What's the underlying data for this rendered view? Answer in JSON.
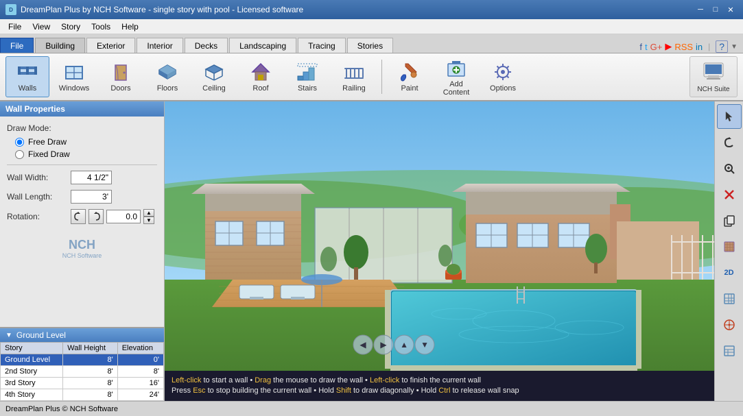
{
  "titleBar": {
    "title": "DreamPlan Plus by NCH Software - single story with pool - Licensed software",
    "iconText": "D",
    "minBtn": "─",
    "maxBtn": "□",
    "closeBtn": "✕"
  },
  "menuBar": {
    "items": [
      "File",
      "View",
      "Story",
      "Tools",
      "Help"
    ]
  },
  "tabs": {
    "main": [
      {
        "label": "File",
        "active": true
      },
      {
        "label": "Building",
        "active": false
      },
      {
        "label": "Exterior",
        "active": false
      },
      {
        "label": "Interior",
        "active": false
      },
      {
        "label": "Decks",
        "active": false
      },
      {
        "label": "Landscaping",
        "active": false
      },
      {
        "label": "Tracing",
        "active": false
      },
      {
        "label": "Stories",
        "active": false
      }
    ]
  },
  "toolbar": {
    "tools": [
      {
        "id": "walls",
        "label": "Walls",
        "active": true
      },
      {
        "id": "windows",
        "label": "Windows",
        "active": false
      },
      {
        "id": "doors",
        "label": "Doors",
        "active": false
      },
      {
        "id": "floors",
        "label": "Floors",
        "active": false
      },
      {
        "id": "ceiling",
        "label": "Ceiling",
        "active": false
      },
      {
        "id": "roof",
        "label": "Roof",
        "active": false
      },
      {
        "id": "stairs",
        "label": "Stairs",
        "active": false
      },
      {
        "id": "railing",
        "label": "Railing",
        "active": false
      },
      {
        "id": "paint",
        "label": "Paint",
        "active": false
      },
      {
        "id": "addcontent",
        "label": "Add Content",
        "active": false
      },
      {
        "id": "options",
        "label": "Options",
        "active": false
      }
    ],
    "nchSuite": "NCH Suite"
  },
  "wallProperties": {
    "title": "Wall Properties",
    "drawModeLabel": "Draw Mode:",
    "freeDrawLabel": "Free Draw",
    "fixedDrawLabel": "Fixed Draw",
    "wallWidthLabel": "Wall Width:",
    "wallWidthValue": "4 1/2\"",
    "wallLengthLabel": "Wall Length:",
    "wallLengthValue": "3'",
    "rotationLabel": "Rotation:",
    "rotationValue": "0.0"
  },
  "groundLevel": {
    "title": "Ground Level",
    "table": {
      "headers": [
        "Story",
        "Wall Height",
        "Elevation"
      ],
      "rows": [
        {
          "story": "Ground Level",
          "wallHeight": "8'",
          "elevation": "0'",
          "selected": true
        },
        {
          "story": "2nd Story",
          "wallHeight": "8'",
          "elevation": "8'",
          "selected": false
        },
        {
          "story": "3rd Story",
          "wallHeight": "8'",
          "elevation": "16'",
          "selected": false
        },
        {
          "story": "4th Story",
          "wallHeight": "8'",
          "elevation": "24'",
          "selected": false
        }
      ]
    }
  },
  "rightToolbar": {
    "buttons": [
      {
        "id": "cursor",
        "icon": "☜",
        "label": "cursor-tool"
      },
      {
        "id": "rotate",
        "icon": "↺",
        "label": "rotate-tool"
      },
      {
        "id": "zoom",
        "icon": "⊕",
        "label": "zoom-tool"
      },
      {
        "id": "delete",
        "icon": "✕",
        "label": "delete-tool"
      },
      {
        "id": "copy",
        "icon": "⧉",
        "label": "copy-tool"
      },
      {
        "id": "texture",
        "icon": "▦",
        "label": "texture-tool"
      },
      {
        "id": "2d",
        "icon": "2D",
        "label": "2d-view"
      },
      {
        "id": "grid",
        "icon": "⊞",
        "label": "grid-tool"
      },
      {
        "id": "measure",
        "icon": "⊗",
        "label": "measure-tool"
      },
      {
        "id": "table",
        "icon": "⊟",
        "label": "table-tool"
      }
    ]
  },
  "statusBar": {
    "line1": "Left-click to start a wall  •  Drag the mouse to draw the wall  •  Left-click to finish the current wall",
    "line2": "Press Esc to stop building the current wall  •  Hold Shift to draw diagonally  •  Hold Ctrl to release wall snap",
    "line1_yellow_parts": [
      "Left-click",
      "Drag",
      "Left-click"
    ],
    "footerText": "DreamPlan Plus © NCH Software"
  },
  "colors": {
    "titleBg": "#2d5f9e",
    "tabActiveBg": "#2d6bbf",
    "toolbarBg": "#f0f0f0",
    "panelHeaderBg": "#4a7fc0",
    "selectedRowBg": "#3060b8",
    "statusBg": "#1a1a2e",
    "statusTextYellow": "#f0c040",
    "statusTextWhite": "#e8e8e8"
  }
}
